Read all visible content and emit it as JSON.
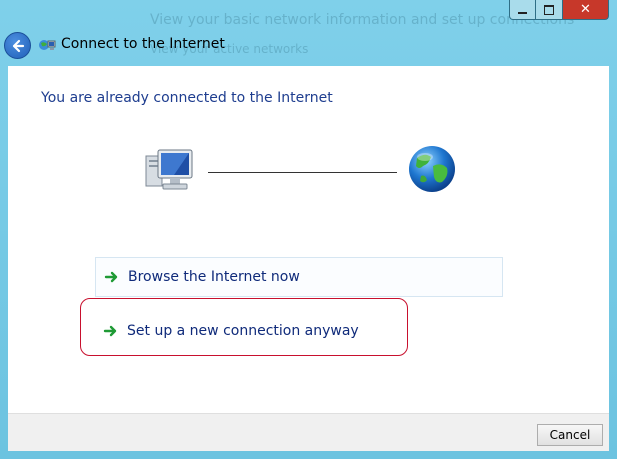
{
  "window": {
    "title": "Connect to the Internet",
    "background_text_1": "View your basic network information and set up connections",
    "background_text_2": "View your active networks"
  },
  "main": {
    "heading": "You are already connected to the Internet",
    "options": [
      {
        "label": "Browse the Internet now"
      },
      {
        "label": "Set up a new connection anyway"
      }
    ]
  },
  "footer": {
    "cancel_label": "Cancel"
  },
  "colors": {
    "accent": "#1e3d8f",
    "highlight": "#c8102e",
    "frame": "#6ec5e2",
    "close": "#c7382a"
  },
  "icons": {
    "back": "back-arrow-icon",
    "title": "network-icon",
    "computer": "computer-icon",
    "globe": "globe-icon",
    "option": "green-arrow-icon"
  }
}
